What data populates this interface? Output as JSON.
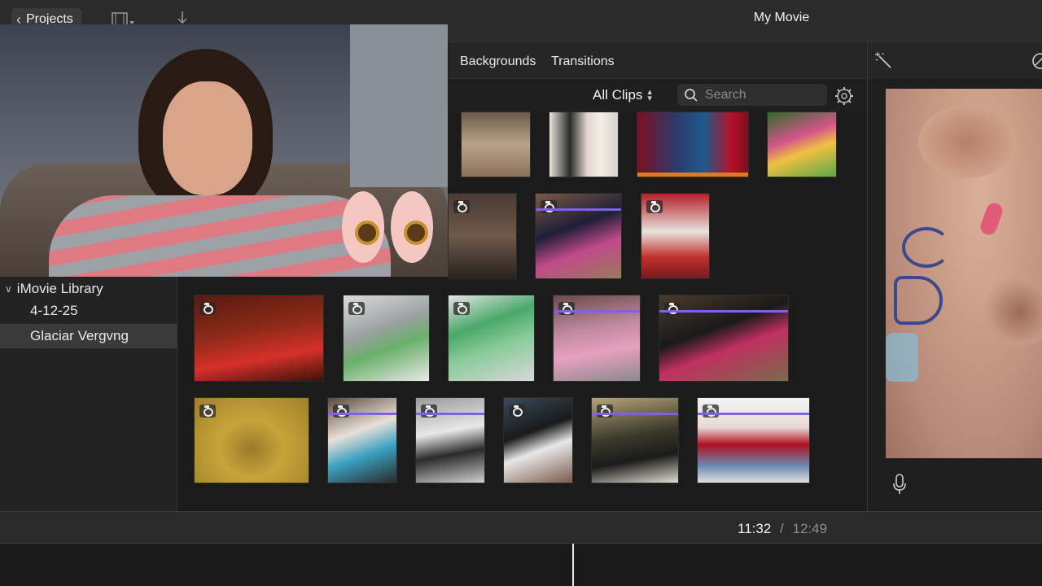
{
  "window": {
    "title": "My Movie"
  },
  "toolbar": {
    "projects_label": "Projects"
  },
  "browser": {
    "tabs": [
      "Backgrounds",
      "Transitions"
    ],
    "filter_label": "All Clips",
    "search_placeholder": "Search"
  },
  "library": {
    "root_label": "iMovie Library",
    "events": [
      "4-12-25",
      "Glaciar Vergvng"
    ],
    "selected_event": "Glaciar Vergvng"
  },
  "timeline": {
    "current_time": "11:32",
    "separator": "/",
    "total_time": "12:49"
  },
  "colors": {
    "accent_bar": "#7b62e8",
    "selection_row": "#3a3a3a"
  },
  "icons": [
    "chevron-left-icon",
    "film-strip-icon",
    "import-arrow-icon",
    "magic-wand-icon",
    "color-balance-icon",
    "camera-icon",
    "gear-icon",
    "search-icon",
    "microphone-icon"
  ]
}
